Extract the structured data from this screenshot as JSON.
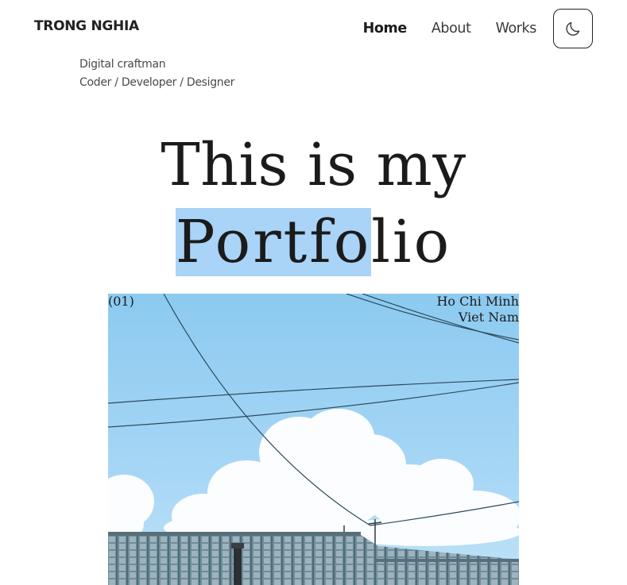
{
  "header": {
    "brand": "TRONG NGHIA",
    "nav": [
      {
        "label": "Home",
        "active": true
      },
      {
        "label": "About",
        "active": false
      },
      {
        "label": "Works",
        "active": false
      }
    ],
    "theme_toggle_icon": "moon-icon"
  },
  "tagline": {
    "line1": "Digital craftman",
    "line2": "Coder / Developer / Designer"
  },
  "hero": {
    "line1": "This is my",
    "line2_selected": "Portfo",
    "line2_rest": "lio"
  },
  "photo": {
    "index": "(01)",
    "location_line1": "Ho Chi Minh",
    "location_line2": "Viet Nam"
  },
  "colors": {
    "selection": "#a9d3f7",
    "sky": "#8ccaf0",
    "text": "#1b1b1b"
  }
}
